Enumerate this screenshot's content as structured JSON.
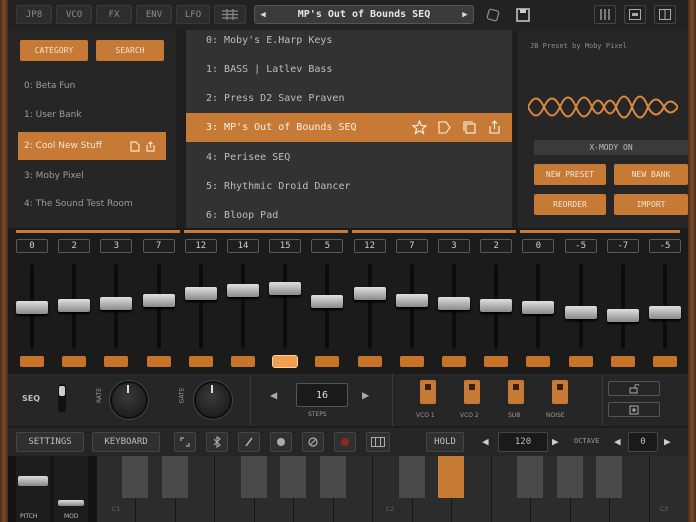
{
  "topbar": {
    "tabs": [
      "JP8",
      "VCO",
      "FX",
      "ENV",
      "LFO"
    ],
    "preset_name": "MP's Out of Bounds SEQ"
  },
  "browser": {
    "category_btn": "CATEGORY",
    "search_btn": "SEARCH",
    "banks": [
      "0: Beta Fun",
      "1: User Bank",
      "2: Cool New Stuff",
      "3: Moby Pixel",
      "4: The Sound Test Room"
    ],
    "presets": [
      "0: Moby's E.Harp Keys",
      "1: BASS | Latlev Bass",
      "2: Press D2 Save Praven",
      "3: MP's Out of Bounds SEQ",
      "4: Perisee SEQ",
      "5: Rhythmic Droid Dancer",
      "6: Bloop Pad"
    ],
    "preset_by": "JB Preset by Moby Pixel",
    "xmod": "X-MODY ON",
    "new_preset": "NEW PRESET",
    "new_bank": "NEW BANK",
    "reorder": "REORDER",
    "import": "IMPORT"
  },
  "sequencer": {
    "values": [
      "0",
      "2",
      "3",
      "7",
      "12",
      "14",
      "15",
      "5",
      "12",
      "7",
      "3",
      "2",
      "0",
      "-5",
      "-7",
      "-5"
    ],
    "levels": [
      0.5,
      0.52,
      0.54,
      0.58,
      0.66,
      0.7,
      0.72,
      0.56,
      0.66,
      0.58,
      0.54,
      0.52,
      0.5,
      0.44,
      0.4,
      0.44
    ],
    "active_step": 6
  },
  "controls": {
    "seq_label": "SEQ",
    "rate_label": "RATE",
    "gate_label": "GATE",
    "steps_value": "16",
    "steps_label": "STEPS",
    "osc": [
      "VCO 1",
      "VCO 2",
      "SUB",
      "NOISE"
    ]
  },
  "bottombar": {
    "settings": "SETTINGS",
    "keyboard": "KEYBOARD",
    "hold": "HOLD",
    "tempo": "120",
    "octave_label": "OCTAVE",
    "octave_value": "0"
  },
  "keyboard": {
    "pitch_label": "PITCH",
    "mod_label": "MOD",
    "c_labels": [
      "C1",
      "C2",
      "C3"
    ]
  },
  "colors": {
    "accent": "#c67a35",
    "panel": "#262626",
    "background": "#1e1e1e"
  }
}
